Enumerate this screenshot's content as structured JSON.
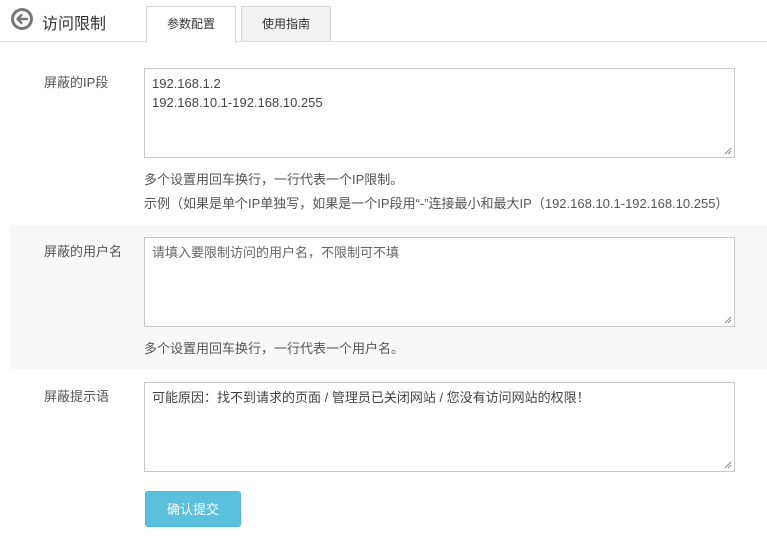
{
  "header": {
    "title": "访问限制",
    "tabs": [
      {
        "label": "参数配置",
        "active": true
      },
      {
        "label": "使用指南",
        "active": false
      }
    ]
  },
  "form": {
    "ip_block": {
      "label": "屏蔽的IP段",
      "lines": [
        "192.168.1.2",
        "192.168.10.1-192.168.10.255"
      ],
      "hint1": "多个设置用回车换行，一行代表一个IP限制。",
      "hint2": "示例（如果是单个IP单独写，如果是一个IP段用“-”连接最小和最大IP（192.168.10.1-192.168.10.255）"
    },
    "user_block": {
      "label": "屏蔽的用户名",
      "placeholder": "请填入要限制访问的用户名，不限制可不填",
      "hint": "多个设置用回车换行，一行代表一个用户名。"
    },
    "message": {
      "label": "屏蔽提示语",
      "value": "可能原因：找不到请求的页面 / 管理员已关闭网站 / 您没有访问网站的权限！"
    },
    "submit_label": "确认提交"
  },
  "colors": {
    "submit_bg": "#5bc0de",
    "shaded_row": "#f8f8f8",
    "border": "#c8c8c8"
  }
}
